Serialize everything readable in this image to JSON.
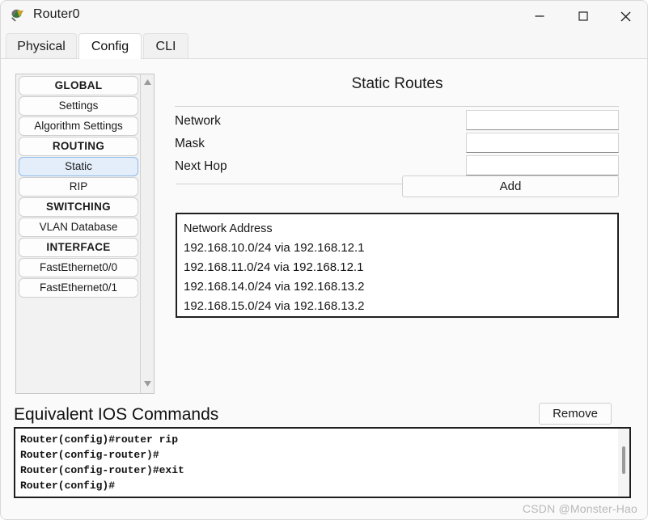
{
  "window": {
    "title": "Router0",
    "icon": "router-device-icon",
    "controls": {
      "minimize": "minimize-icon",
      "maximize": "maximize-icon",
      "close": "close-icon"
    }
  },
  "tabs": [
    {
      "id": "physical",
      "label": "Physical",
      "active": false
    },
    {
      "id": "config",
      "label": "Config",
      "active": true
    },
    {
      "id": "cli",
      "label": "CLI",
      "active": false
    }
  ],
  "sidebar": {
    "items": [
      {
        "label": "GLOBAL",
        "type": "header",
        "selected": false
      },
      {
        "label": "Settings",
        "type": "item",
        "selected": false
      },
      {
        "label": "Algorithm Settings",
        "type": "item",
        "selected": false
      },
      {
        "label": "ROUTING",
        "type": "header",
        "selected": false
      },
      {
        "label": "Static",
        "type": "item",
        "selected": true
      },
      {
        "label": "RIP",
        "type": "item",
        "selected": false
      },
      {
        "label": "SWITCHING",
        "type": "header",
        "selected": false
      },
      {
        "label": "VLAN Database",
        "type": "item",
        "selected": false
      },
      {
        "label": "INTERFACE",
        "type": "header",
        "selected": false
      },
      {
        "label": "FastEthernet0/0",
        "type": "item",
        "selected": false
      },
      {
        "label": "FastEthernet0/1",
        "type": "item",
        "selected": false
      }
    ],
    "scroll_up_icon": "triangle-up-icon",
    "scroll_down_icon": "triangle-down-icon"
  },
  "static_routes": {
    "title": "Static Routes",
    "fields": {
      "network_label": "Network",
      "network_value": "",
      "mask_label": "Mask",
      "mask_value": "",
      "next_hop_label": "Next Hop",
      "next_hop_value": ""
    },
    "add_button": "Add",
    "remove_button": "Remove",
    "list_header": "Network Address",
    "entries": [
      "192.168.10.0/24 via 192.168.12.1",
      "192.168.11.0/24 via 192.168.12.1",
      "192.168.14.0/24 via 192.168.13.2",
      "192.168.15.0/24 via 192.168.13.2"
    ]
  },
  "ios": {
    "heading": "Equivalent IOS Commands",
    "lines": [
      "Router(config)#router rip",
      "Router(config-router)#",
      "Router(config-router)#exit",
      "Router(config)#"
    ]
  },
  "watermark": "CSDN @Monster-Hao"
}
